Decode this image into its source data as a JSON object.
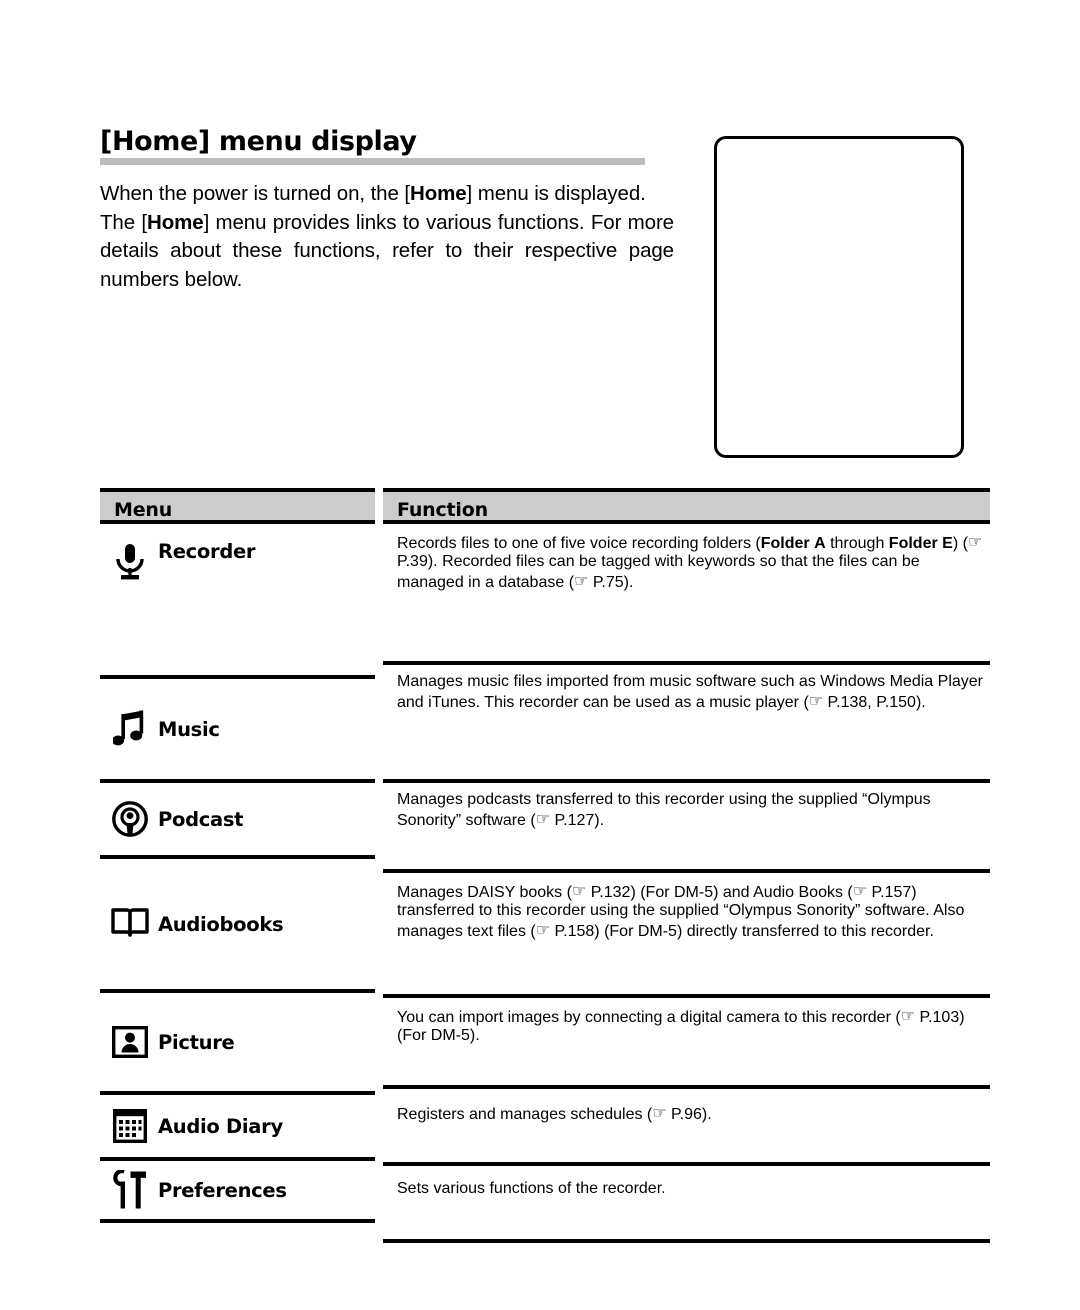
{
  "page": {
    "heading": "[Home] menu display",
    "intro": {
      "line1_a": "When the power is turned on, the [",
      "line1_b": "Home",
      "line1_c": "] menu is displayed.",
      "line2_a": "The [",
      "line2_b": "Home",
      "line2_c": "] menu provides links to various functions.",
      "line3": "For more details about these functions, refer to their",
      "line4": "respective page numbers below."
    },
    "device_box": {
      "name": "home-menu-screenshot-placeholder",
      "content": ""
    }
  },
  "table": {
    "headers": {
      "menu": "Menu",
      "function": "Function"
    },
    "header_bg": "#cccccc",
    "rule_color": "#000000",
    "rows": [
      {
        "id": "recorder",
        "icon": "microphone-icon",
        "label": "Recorder",
        "lines": [
          {
            "text": "Records files to one of five voice recording folders (",
            "justify": true
          },
          {
            "text": "Folder",
            "bold": true,
            "append": true
          },
          {
            "text": "A",
            "bold": true
          },
          {
            "text": " through ",
            "bold": false
          },
          {
            "text": "Folder E",
            "bold": true
          },
          {
            "text": ") (☞ P.39). Recorded files can be tagged"
          },
          {
            "text": "with keywords so that the files can be managed in a database"
          },
          {
            "text": "(☞ P.75)."
          }
        ]
      },
      {
        "id": "music",
        "icon": "music-note-icon",
        "label": "Music",
        "lines": [
          {
            "text": "Manages music files imported from music software such as"
          },
          {
            "text": "Windows Media Player and iTunes. This recorder can be used"
          },
          {
            "text": "as a music player (☞ P.138, P.150)."
          }
        ]
      },
      {
        "id": "podcast",
        "icon": "podcast-icon",
        "label": "Podcast",
        "lines": [
          {
            "text": "Manages podcasts transferred to this recorder using the"
          },
          {
            "text": "supplied “Olympus Sonority” software (☞ P.127)."
          }
        ]
      },
      {
        "id": "audiobooks",
        "icon": "open-book-icon",
        "label": "Audiobooks",
        "lines": [
          {
            "text": "Manages DAISY books (☞ P.132) (For DM-5) and Audio Books"
          },
          {
            "text": "(☞ P.157) transferred to this recorder using the supplied"
          },
          {
            "text": "“Olympus Sonority” software. Also manages text files (☞ P.158)"
          },
          {
            "text": "(For DM-5) directly transferred to this recorder."
          }
        ]
      },
      {
        "id": "picture",
        "icon": "picture-frame-icon",
        "label": "Picture",
        "lines": [
          {
            "text": "You can import images by connecting a digital camera to this"
          },
          {
            "text": "recorder (☞ P.103) (For DM-5)."
          }
        ]
      },
      {
        "id": "diary",
        "icon": "calendar-icon",
        "label": "Audio Diary",
        "lines": [
          {
            "text": "Registers and manages schedules (☞ P.96)."
          }
        ]
      },
      {
        "id": "prefs",
        "icon": "wrench-hammer-icon",
        "label": "Preferences",
        "lines": [
          {
            "text": "Sets various functions of the recorder."
          }
        ]
      }
    ]
  }
}
